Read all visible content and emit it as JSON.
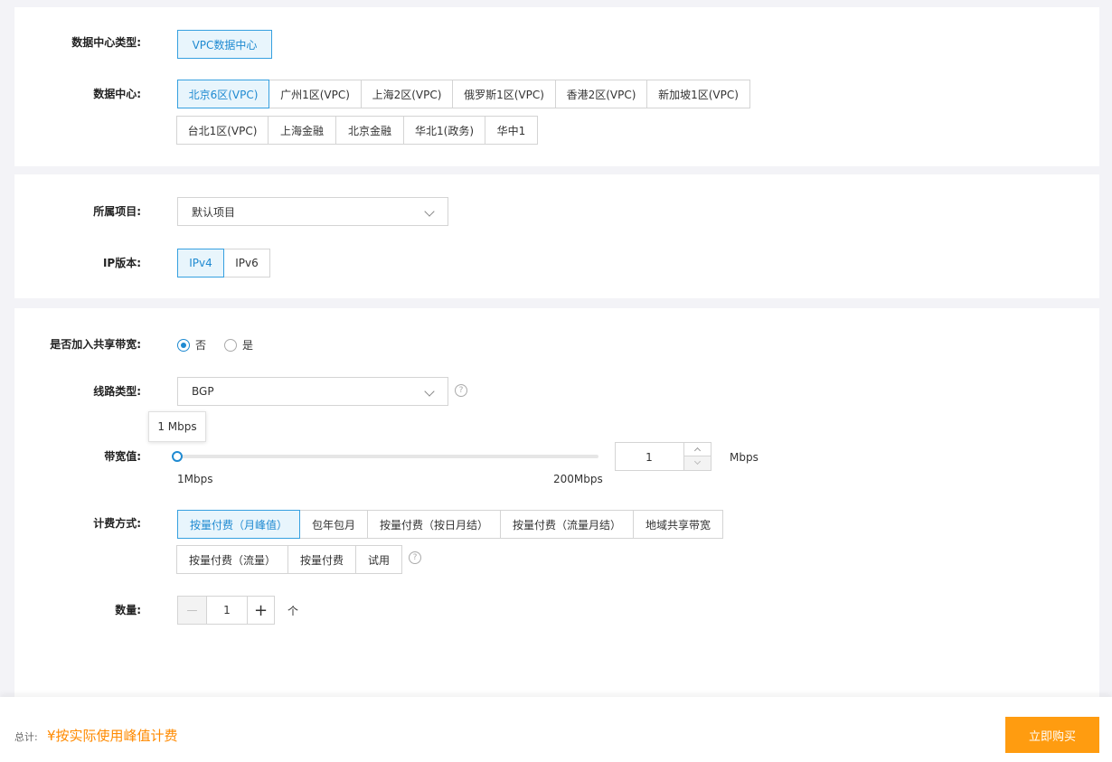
{
  "datacenter_type": {
    "label": "数据中心类型:",
    "options": [
      "VPC数据中心"
    ]
  },
  "datacenter": {
    "label": "数据中心:",
    "row1": [
      "北京6区(VPC)",
      "广州1区(VPC)",
      "上海2区(VPC)",
      "俄罗斯1区(VPC)",
      "香港2区(VPC)",
      "新加坡1区(VPC)"
    ],
    "row2": [
      "台北1区(VPC)",
      "上海金融",
      "北京金融",
      "华北1(政务)",
      "华中1"
    ]
  },
  "project": {
    "label": "所属项目:",
    "value": "默认项目"
  },
  "ip_version": {
    "label": "IP版本:",
    "options": [
      "IPv4",
      "IPv6"
    ]
  },
  "shared_bandwidth": {
    "label": "是否加入共享带宽:",
    "options": [
      "否",
      "是"
    ]
  },
  "line_type": {
    "label": "线路类型:",
    "value": "BGP"
  },
  "bandwidth": {
    "label": "带宽值:",
    "tooltip": "1 Mbps",
    "min_label": "1Mbps",
    "max_label": "200Mbps",
    "value": "1",
    "unit": "Mbps",
    "min": 1,
    "max": 200
  },
  "billing": {
    "label": "计费方式:",
    "row1": [
      "按量付费（月峰值）",
      "包年包月",
      "按量付费（按日月结）",
      "按量付费（流量月结）",
      "地域共享带宽"
    ],
    "row2": [
      "按量付费（流量）",
      "按量付费",
      "试用"
    ]
  },
  "quantity": {
    "label": "数量:",
    "minus": "—",
    "value": "1",
    "plus": "+",
    "unit": "个"
  },
  "footer": {
    "total_label": "总计:",
    "price": "¥按实际使用峰值计费",
    "buy_button": "立即购买"
  },
  "help_glyph": "?",
  "colors": {
    "accent": "#1f8ad1",
    "active_bg": "#e8f5fc",
    "buy_button": "#ff9c10",
    "price": "#ff8a00"
  }
}
